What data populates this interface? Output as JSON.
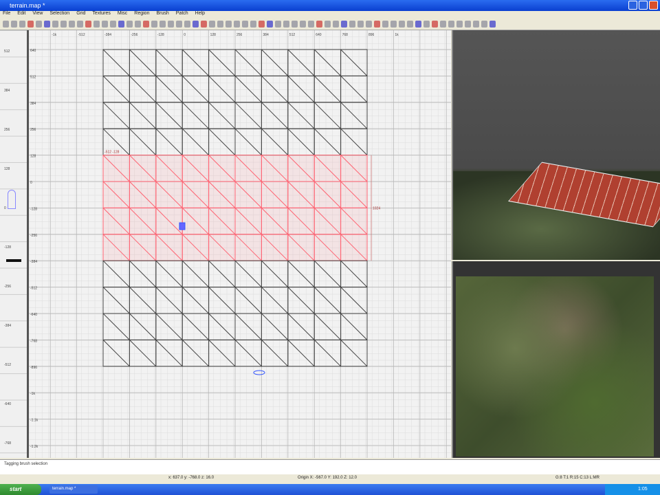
{
  "window": {
    "title": "terrain.map *"
  },
  "menu": [
    "File",
    "Edit",
    "View",
    "Selection",
    "Grid",
    "Textures",
    "Misc",
    "Region",
    "Brush",
    "Patch",
    "Help"
  ],
  "ruler": {
    "x_labels": [
      "-1k",
      "-512",
      "-384",
      "-256",
      "-128",
      "0",
      "128",
      "256",
      "384",
      "512",
      "640",
      "768",
      "896",
      "1k"
    ],
    "y_labels": [
      "640",
      "512",
      "384",
      "256",
      "128",
      "0",
      "-128",
      "-256",
      "-384",
      "-512",
      "-640",
      "-768",
      "-896",
      "-1k",
      "-1.1k",
      "-1.2k"
    ],
    "z_labels": [
      "512",
      "384",
      "256",
      "128",
      "0",
      "-128",
      "-256",
      "-384",
      "-512",
      "-640",
      "-768"
    ]
  },
  "patch": {
    "cols": 10,
    "rows": 12,
    "selected_rows": [
      4,
      5,
      6,
      7
    ],
    "label": "1024",
    "size_label": "-512 -128"
  },
  "colors": {
    "mesh": "#444444",
    "selected": "#ff6070",
    "accent": "#3355ff"
  },
  "message": "Tagging brush selection",
  "status": {
    "coords": "x: 637.0  y: -768.0  z: 16.0",
    "brush": "Origin X: -567.0  Y: 192.0  Z: 12.0",
    "grid": "G:8 T:1 R:15 C:13 L:MR"
  },
  "taskbar": {
    "start": "start",
    "task": "terrain.map *",
    "clock": "1:05"
  }
}
